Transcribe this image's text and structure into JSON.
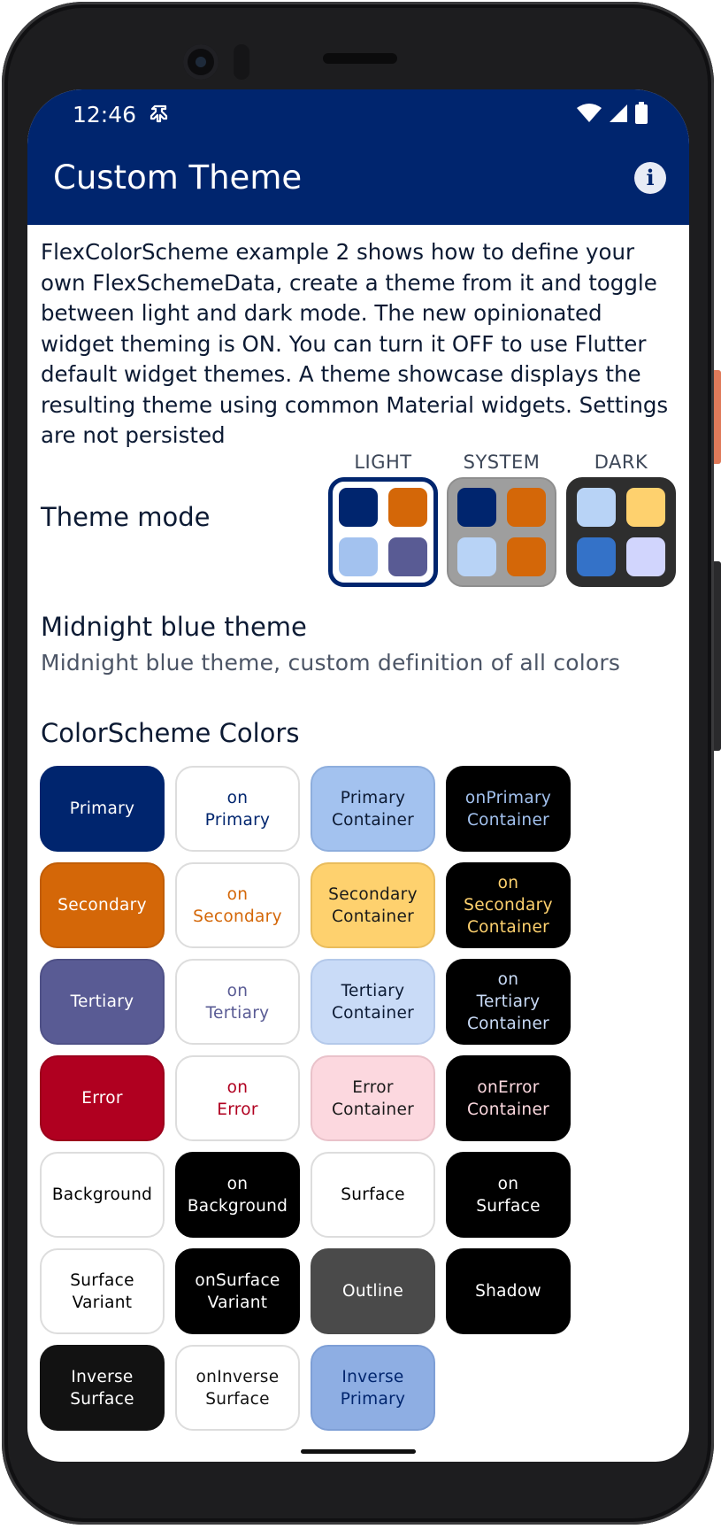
{
  "status_bar": {
    "time": "12:46"
  },
  "app_bar": {
    "title": "Custom Theme"
  },
  "description": "FlexColorScheme example 2 shows how to define your own FlexSchemeData, create a theme from it and toggle between light and dark mode. The new opinionated widget theming is ON. You can turn it OFF to use Flutter default widget themes. A theme showcase displays the resulting theme using common Material widgets. Settings are not persisted",
  "theme_mode": {
    "label": "Theme mode",
    "options": [
      {
        "label": "LIGHT",
        "selected": true,
        "bg": "#ffffff",
        "border": "#00256e",
        "swatches": [
          "#00256e",
          "#d46708",
          "#a3c2ef",
          "#595b94"
        ]
      },
      {
        "label": "SYSTEM",
        "selected": false,
        "bg": "#9e9e9e",
        "border": "#8e8e8e",
        "swatches": [
          "#00256e",
          "#d46708",
          "#b8d3f6",
          "#d46708"
        ]
      },
      {
        "label": "DARK",
        "selected": false,
        "bg": "#2e2e2e",
        "border": "#2e2e2e",
        "swatches": [
          "#b8d3f6",
          "#fed16e",
          "#3472c8",
          "#d1d5fd"
        ]
      }
    ]
  },
  "theme": {
    "name": "Midnight blue theme",
    "description": "Midnight blue theme, custom definition of all colors"
  },
  "color_scheme": {
    "title": "ColorScheme Colors",
    "tiles": [
      {
        "label": "Primary",
        "bg": "#00256e",
        "fg": "#ffffff",
        "border": "#00256e"
      },
      {
        "label": "on\nPrimary",
        "bg": "#ffffff",
        "fg": "#00256e",
        "border": "#dddddd"
      },
      {
        "label": "Primary\nContainer",
        "bg": "#a3c2ef",
        "fg": "#0c1a33",
        "border": "#8eaedd"
      },
      {
        "label": "onPrimary\nContainer",
        "bg": "#000000",
        "fg": "#a3c2ef",
        "border": "#000000"
      },
      {
        "label": "Secondary",
        "bg": "#d46708",
        "fg": "#ffffff",
        "border": "#c05d07"
      },
      {
        "label": "on\nSecondary",
        "bg": "#ffffff",
        "fg": "#d46708",
        "border": "#dddddd"
      },
      {
        "label": "Secondary\nContainer",
        "bg": "#fed16e",
        "fg": "#1a1a1a",
        "border": "#e9bc5c"
      },
      {
        "label": "on\nSecondary\nContainer",
        "bg": "#000000",
        "fg": "#fed16e",
        "border": "#000000"
      },
      {
        "label": "Tertiary",
        "bg": "#595b94",
        "fg": "#ffffff",
        "border": "#4f5187"
      },
      {
        "label": "on\nTertiary",
        "bg": "#ffffff",
        "fg": "#595b94",
        "border": "#dddddd"
      },
      {
        "label": "Tertiary\nContainer",
        "bg": "#c9dbf7",
        "fg": "#0c1a33",
        "border": "#b4c9ea"
      },
      {
        "label": "on\nTertiary\nContainer",
        "bg": "#000000",
        "fg": "#c9dbf7",
        "border": "#000000"
      },
      {
        "label": "Error",
        "bg": "#b00020",
        "fg": "#ffffff",
        "border": "#9c001c"
      },
      {
        "label": "on\nError",
        "bg": "#ffffff",
        "fg": "#b00020",
        "border": "#dddddd"
      },
      {
        "label": "Error\nContainer",
        "bg": "#fcd8df",
        "fg": "#1a1a1a",
        "border": "#e9c2ca"
      },
      {
        "label": "onError\nContainer",
        "bg": "#000000",
        "fg": "#fcd8df",
        "border": "#000000"
      },
      {
        "label": "Background",
        "bg": "#ffffff",
        "fg": "#000000",
        "border": "#dddddd"
      },
      {
        "label": "on\nBackground",
        "bg": "#000000",
        "fg": "#ffffff",
        "border": "#000000"
      },
      {
        "label": "Surface",
        "bg": "#ffffff",
        "fg": "#000000",
        "border": "#dddddd"
      },
      {
        "label": "on\nSurface",
        "bg": "#000000",
        "fg": "#ffffff",
        "border": "#000000"
      },
      {
        "label": "Surface\nVariant",
        "bg": "#ffffff",
        "fg": "#000000",
        "border": "#dddddd"
      },
      {
        "label": "onSurface\nVariant",
        "bg": "#000000",
        "fg": "#ffffff",
        "border": "#000000"
      },
      {
        "label": "Outline",
        "bg": "#4a4a4a",
        "fg": "#ffffff",
        "border": "#4a4a4a"
      },
      {
        "label": "Shadow",
        "bg": "#000000",
        "fg": "#ffffff",
        "border": "#000000"
      },
      {
        "label": "Inverse\nSurface",
        "bg": "#121212",
        "fg": "#ffffff",
        "border": "#121212"
      },
      {
        "label": "onInverse\nSurface",
        "bg": "#ffffff",
        "fg": "#121212",
        "border": "#dddddd"
      },
      {
        "label": "Inverse\nPrimary",
        "bg": "#8eaee3",
        "fg": "#00256e",
        "border": "#7e9fd6"
      }
    ]
  }
}
